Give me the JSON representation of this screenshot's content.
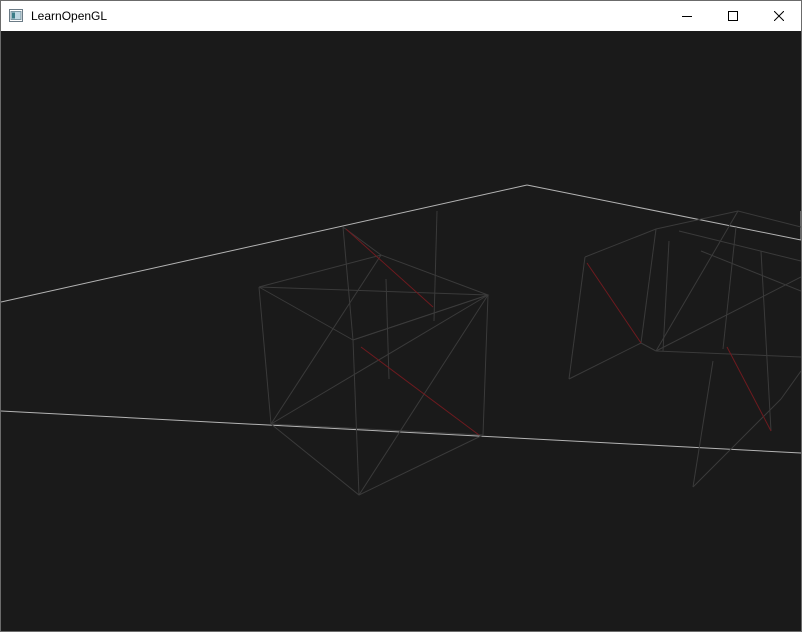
{
  "window": {
    "title": "LearnOpenGL",
    "app_icon": "opengl-window-icon",
    "controls": {
      "minimize_icon": "minimize-icon",
      "maximize_icon": "maximize-icon",
      "close_icon": "close-icon"
    }
  },
  "scene": {
    "description_icon": "wireframe-scene",
    "clear_color": "#1a1a1a",
    "plane_line_color": "#b4b4b4",
    "cube_edge_color": "#3a3a3a",
    "accent_edge_color": "#6e1a1f"
  }
}
